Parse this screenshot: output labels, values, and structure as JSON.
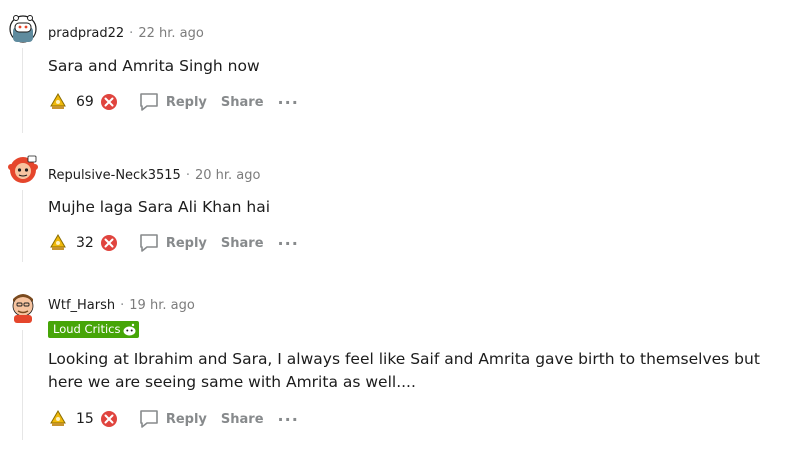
{
  "comments": [
    {
      "username": "pradprad22",
      "separator": "·",
      "time": "22 hr. ago",
      "text": "Sara and Amrita Singh now",
      "score": "69",
      "reply_label": "Reply",
      "share_label": "Share",
      "more_label": "···"
    },
    {
      "username": "Repulsive-Neck3515",
      "separator": "·",
      "time": "20 hr. ago",
      "text": "Mujhe laga Sara Ali Khan hai",
      "score": "32",
      "reply_label": "Reply",
      "share_label": "Share",
      "more_label": "···"
    },
    {
      "username": "Wtf_Harsh",
      "separator": "·",
      "time": "19 hr. ago",
      "flair": "Loud Critics",
      "text": "Looking at Ibrahim and Sara, I always feel like Saif and Amrita gave birth to themselves but here we are seeing same with Amrita as well....",
      "score": "15",
      "reply_label": "Reply",
      "share_label": "Share",
      "more_label": "···"
    }
  ],
  "colors": {
    "flair_bg": "#46a508",
    "award": "#f0b90b",
    "cancel": "#e0443e",
    "muted": "#878a8c"
  },
  "icons": [
    "avatar",
    "award-icon",
    "remove-icon",
    "comment-bubble-icon",
    "more-options-icon",
    "snoo-flair-icon"
  ]
}
